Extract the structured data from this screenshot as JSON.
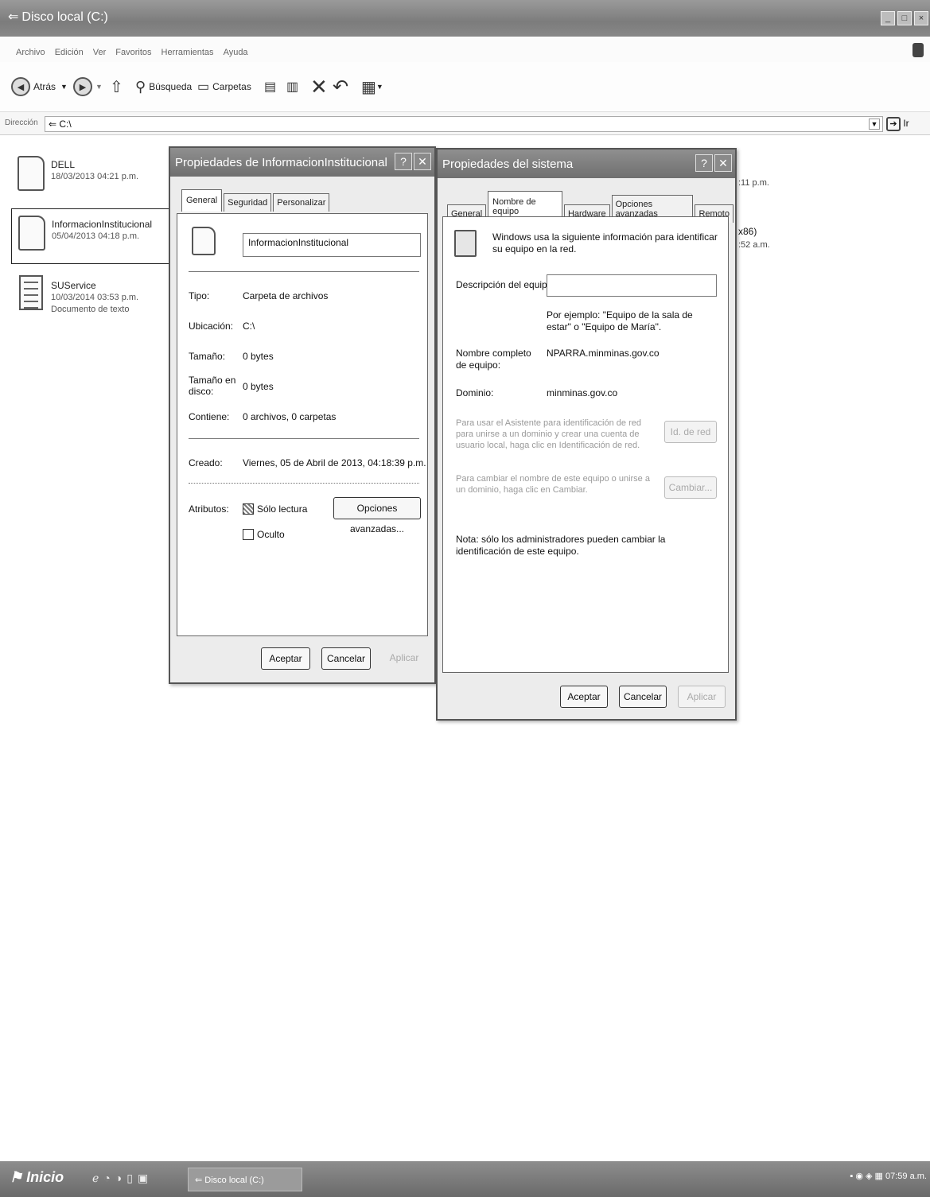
{
  "window": {
    "title": "Disco local (C:)",
    "controls": [
      "_",
      "□",
      "×"
    ]
  },
  "menu": [
    "Archivo",
    "Edición",
    "Ver",
    "Favoritos",
    "Herramientas",
    "Ayuda"
  ],
  "toolbar": {
    "back": "Atrás",
    "search": "Búsqueda",
    "folders": "Carpetas"
  },
  "address": {
    "label": "Dirección",
    "value": "C:\\",
    "go": "Ir"
  },
  "files": [
    {
      "name": "DELL",
      "date": "18/03/2013 04:21 p.m.",
      "icon": "folder-icon"
    },
    {
      "name": "InformacionInstitucional",
      "date": "05/04/2013 04:18 p.m.",
      "icon": "folder-icon"
    },
    {
      "name": "SUService",
      "date": "10/03/2014 03:53 p.m.",
      "desc": "Documento de texto",
      "icon": "text-document-icon"
    }
  ],
  "peek": {
    "a": ":11 p.m.",
    "b": "x86)",
    "c": ":52 a.m."
  },
  "folder_props": {
    "title": "Propiedades de InformacionInstitucional",
    "tabs": [
      "General",
      "Seguridad",
      "Personalizar"
    ],
    "name": "InformacionInstitucional",
    "rows": {
      "tipo_l": "Tipo:",
      "tipo_v": "Carpeta de archivos",
      "ubic_l": "Ubicación:",
      "ubic_v": "C:\\",
      "tam_l": "Tamaño:",
      "tam_v": "0 bytes",
      "tamd_l": "Tamaño en disco:",
      "tamd_v": "0 bytes",
      "cont_l": "Contiene:",
      "cont_v": "0 archivos, 0 carpetas",
      "creado_l": "Creado:",
      "creado_v": "Viernes, 05 de Abril de 2013, 04:18:39 p.m.",
      "attr_l": "Atributos:"
    },
    "readonly": "Sólo lectura",
    "hidden": "Oculto",
    "advanced": "Opciones avanzadas...",
    "ok": "Aceptar",
    "cancel": "Cancelar",
    "apply": "Aplicar"
  },
  "sys_props": {
    "title": "Propiedades del sistema",
    "tabs": [
      "General",
      "Nombre de equipo",
      "Hardware",
      "Opciones avanzadas",
      "Remoto"
    ],
    "intro": "Windows usa la siguiente información para identificar su equipo en la red.",
    "desc_label": "Descripción del equipo:",
    "desc_value": "",
    "example": "Por ejemplo: \"Equipo de la sala de estar\" o \"Equipo de María\".",
    "fullname_label": "Nombre completo de equipo:",
    "fullname_value": "NPARRA.minminas.gov.co",
    "domain_label": "Dominio:",
    "domain_value": "minminas.gov.co",
    "netid_text": "Para usar el Asistente para identificación de red para unirse a un dominio y crear una cuenta de usuario local, haga clic en Identificación de red.",
    "netid_button": "Id. de red",
    "change_text": "Para cambiar el nombre de este equipo o unirse a un dominio, haga clic en Cambiar.",
    "change_button": "Cambiar...",
    "note": "Nota: sólo los administradores pueden cambiar la identificación de este equipo.",
    "ok": "Aceptar",
    "cancel": "Cancelar",
    "apply": "Aplicar"
  },
  "taskbar": {
    "start": "Inicio",
    "item": "Disco local (C:)",
    "clock": "07:59 a.m."
  }
}
